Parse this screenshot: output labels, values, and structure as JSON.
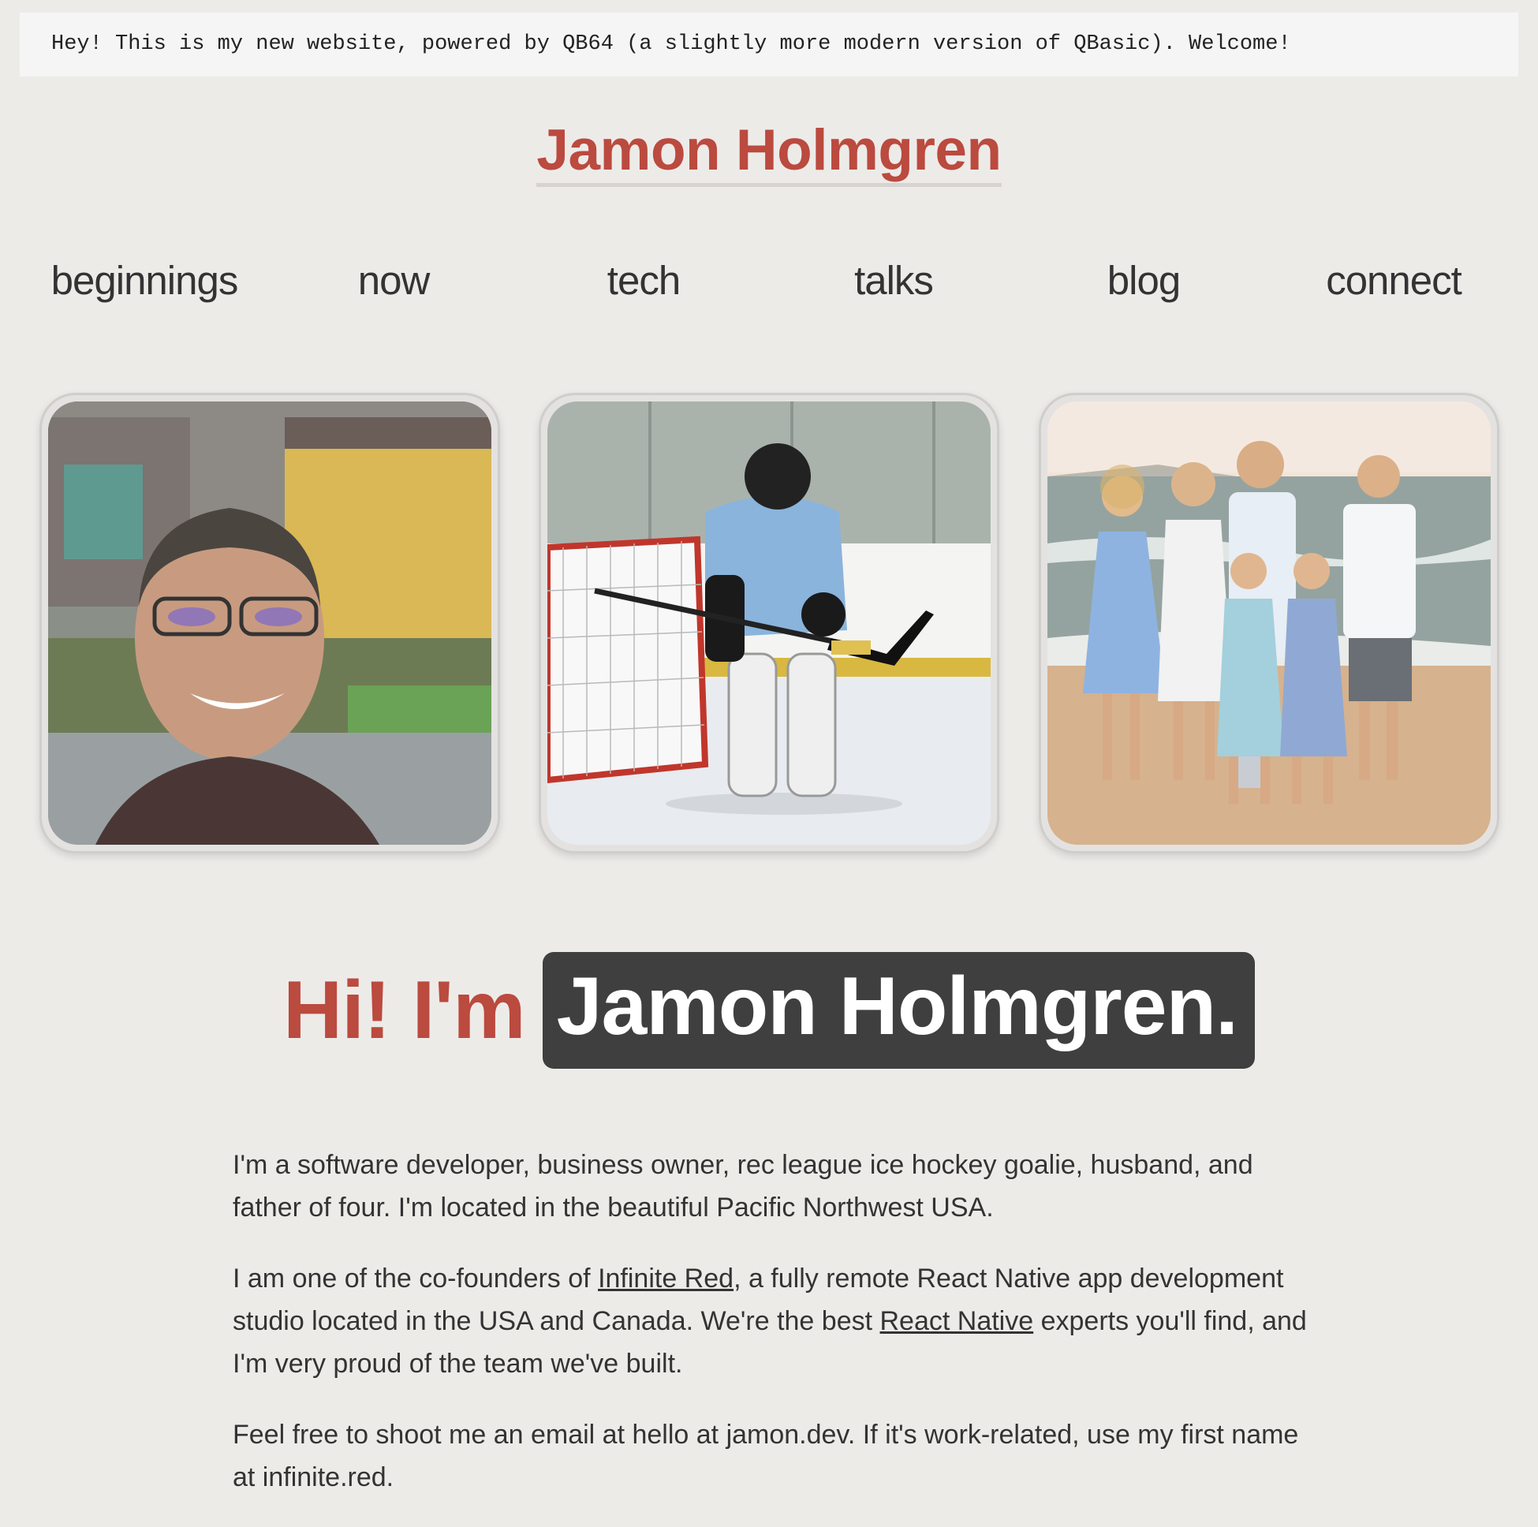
{
  "banner": {
    "text": "Hey! This is my new website, powered by QB64 (a slightly more modern version of QBasic). Welcome!"
  },
  "site_title": "Jamon Holmgren",
  "nav": {
    "items": [
      {
        "label": "beginnings"
      },
      {
        "label": "now"
      },
      {
        "label": "tech"
      },
      {
        "label": "talks"
      },
      {
        "label": "blog"
      },
      {
        "label": "connect"
      }
    ]
  },
  "photos": [
    {
      "icon": "portrait-photo"
    },
    {
      "icon": "hockey-goalie-photo"
    },
    {
      "icon": "family-beach-photo"
    }
  ],
  "hero": {
    "greeting": "Hi! I'm",
    "name": "Jamon Holmgren."
  },
  "about": {
    "p1": "I'm a software developer, business owner, rec league ice hockey goalie, husband, and father of four. I'm located in the beautiful Pacific Northwest USA.",
    "p2_before": "I am one of the co-founders of ",
    "p2_link1": "Infinite Red",
    "p2_middle": ", a fully remote React Native app development studio located in the USA and Canada. We're the best ",
    "p2_link2": "React Native",
    "p2_after": " experts you'll find, and I'm very proud of the team we've built.",
    "p3": "Feel free to shoot me an email at hello at jamon.dev. If it's work-related, use my first name at infinite.red."
  },
  "colors": {
    "accent": "#bb4a3f",
    "background": "#edebe8",
    "name_badge": "#3f3f3f"
  }
}
